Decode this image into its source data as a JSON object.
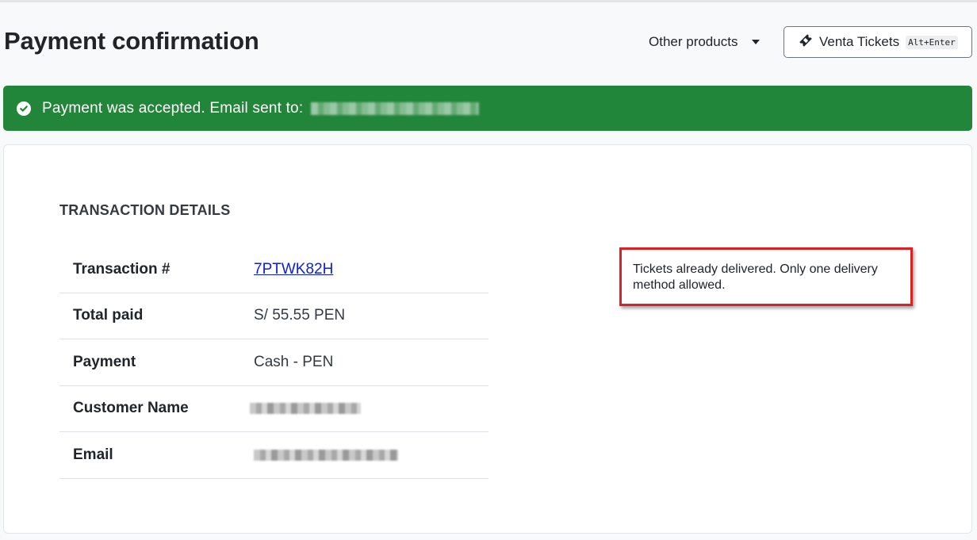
{
  "header": {
    "title": "Payment confirmation",
    "other_products_label": "Other products",
    "venta_button_label": "Venta Tickets",
    "venta_button_shortcut": "Alt+Enter"
  },
  "alert": {
    "message": "Payment was accepted. Email sent to:",
    "color": "#22863a"
  },
  "transaction": {
    "section_title": "TRANSACTION DETAILS",
    "rows": [
      {
        "label": "Transaction #",
        "value": "7PTWK82H"
      },
      {
        "label": "Total paid",
        "value": "S/ 55.55 PEN"
      },
      {
        "label": "Payment",
        "value": "Cash - PEN"
      },
      {
        "label": "Customer Name",
        "value": ""
      },
      {
        "label": "Email",
        "value": ""
      }
    ]
  },
  "notice": {
    "text": "Tickets already delivered. Only one delivery method allowed."
  },
  "icons": {
    "dropdown": "caret-down-icon",
    "ticket": "ticket-icon",
    "success": "check-circle-icon"
  }
}
